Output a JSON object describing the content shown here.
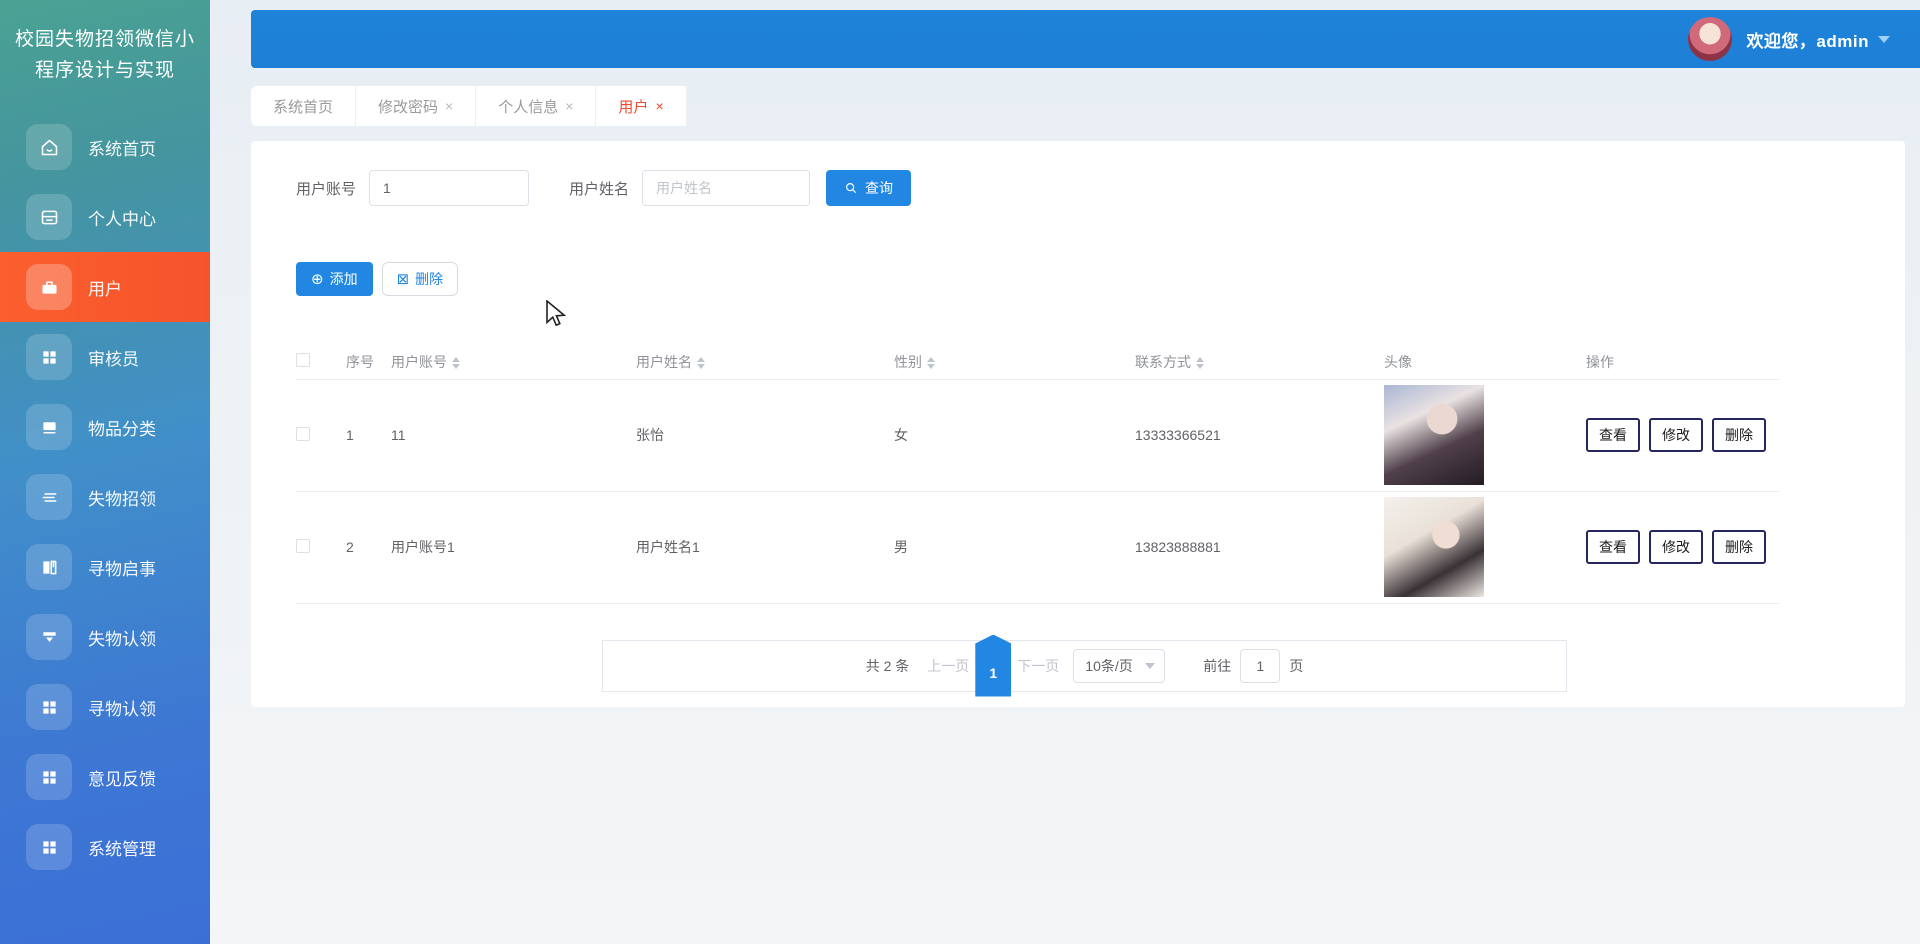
{
  "sidebar": {
    "title": "校园失物招领微信小程序设计与实现",
    "items": [
      {
        "label": "系统首页",
        "icon": "home-icon",
        "active": false
      },
      {
        "label": "个人中心",
        "icon": "id-card-icon",
        "active": false
      },
      {
        "label": "用户",
        "icon": "briefcase-icon",
        "active": true
      },
      {
        "label": "审核员",
        "icon": "grid-icon",
        "active": false
      },
      {
        "label": "物品分类",
        "icon": "chat-stack-icon",
        "active": false
      },
      {
        "label": "失物招领",
        "icon": "list-lines-icon",
        "active": false
      },
      {
        "label": "寻物启事",
        "icon": "book-icon",
        "active": false
      },
      {
        "label": "失物认领",
        "icon": "funnel-icon",
        "active": false
      },
      {
        "label": "寻物认领",
        "icon": "grid-icon",
        "active": false
      },
      {
        "label": "意见反馈",
        "icon": "grid-icon",
        "active": false
      },
      {
        "label": "系统管理",
        "icon": "grid-icon",
        "active": false
      }
    ]
  },
  "header": {
    "welcome": "欢迎您，admin"
  },
  "tabs": [
    {
      "label": "系统首页",
      "closable": false,
      "active": false
    },
    {
      "label": "修改密码",
      "closable": true,
      "active": false
    },
    {
      "label": "个人信息",
      "closable": true,
      "active": false
    },
    {
      "label": "用户",
      "closable": true,
      "active": true
    }
  ],
  "tab_close_glyph": "×",
  "search": {
    "account_label": "用户账号",
    "account_value": "1",
    "name_label": "用户姓名",
    "name_placeholder": "用户姓名",
    "query_label": "查询"
  },
  "toolbar": {
    "add_label": "添加",
    "add_icon_glyph": "⊕",
    "delete_label": "删除",
    "delete_icon_glyph": "⊠"
  },
  "table": {
    "headers": [
      "序号",
      "用户账号",
      "用户姓名",
      "性别",
      "联系方式",
      "头像",
      "操作"
    ],
    "rows": [
      {
        "index": "1",
        "account": "11",
        "name": "张怡",
        "gender": "女",
        "phone": "13333366521",
        "avatar": "avatar-photo-1"
      },
      {
        "index": "2",
        "account": "用户账号1",
        "name": "用户姓名1",
        "gender": "男",
        "phone": "13823888881",
        "avatar": "avatar-photo-2"
      }
    ],
    "actions": [
      "查看",
      "修改",
      "删除"
    ]
  },
  "pagination": {
    "total": "共 2 条",
    "prev": "上一页",
    "page": "1",
    "next": "下一页",
    "page_size": "10条/页",
    "goto_prefix": "前往",
    "goto_value": "1",
    "goto_suffix": "页"
  },
  "colors": {
    "accent_blue": "#2287e2",
    "header_blue": "#1e7fd6",
    "active_orange": "#f6532b",
    "sidebar_teal": "#4aa293",
    "sidebar_blue": "#3c6fd6",
    "active_tab_red": "#f0482e"
  }
}
